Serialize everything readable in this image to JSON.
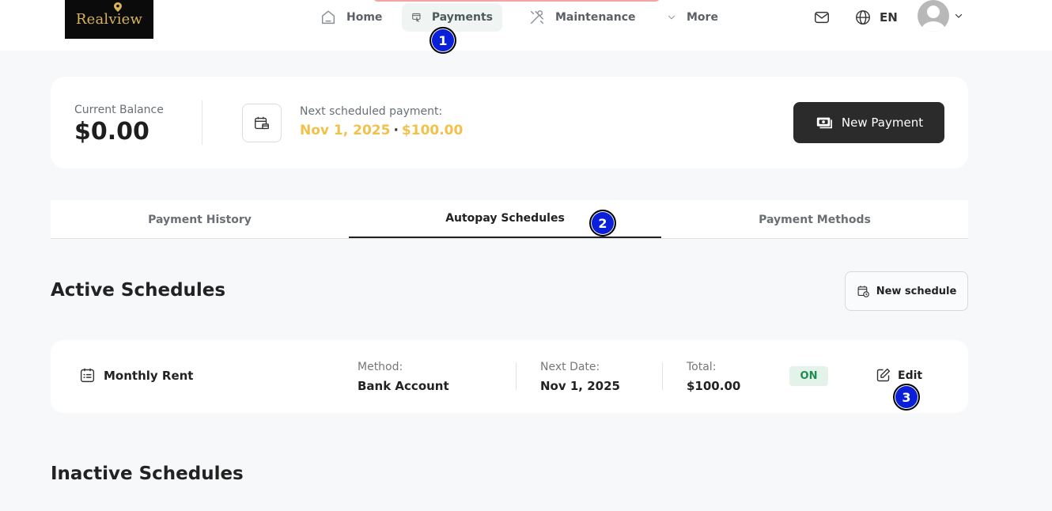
{
  "brand": {
    "name": "Realview",
    "color": "#d8b45a"
  },
  "nav": {
    "home": "Home",
    "payments": "Payments",
    "maintenance": "Maintenance",
    "more": "More",
    "language": "EN"
  },
  "balance": {
    "label": "Current Balance",
    "value": "$0.00",
    "next_label": "Next scheduled payment:",
    "next_date": "Nov 1, 2025",
    "next_separator": "·",
    "next_amount": "$100.00",
    "new_payment_label": "New Payment"
  },
  "tabs": {
    "history": "Payment History",
    "autopay": "Autopay Schedules",
    "methods": "Payment Methods",
    "active": "autopay"
  },
  "active_section": {
    "title": "Active Schedules",
    "new_schedule_label": "New schedule"
  },
  "schedule": {
    "name": "Monthly Rent",
    "method_label": "Method:",
    "method_value": "Bank Account",
    "next_date_label": "Next Date:",
    "next_date_value": "Nov 1, 2025",
    "total_label": "Total:",
    "total_value": "$100.00",
    "status": "ON",
    "edit_label": "Edit"
  },
  "inactive_section": {
    "title": "Inactive Schedules"
  },
  "annotations": [
    "1",
    "2",
    "3"
  ],
  "colors": {
    "accent_amount": "#f0c24b",
    "badge": "#0a20d8",
    "status_on_bg": "#e3f3ea",
    "status_on_text": "#1e8c52",
    "primary_button": "#2b2b2b"
  }
}
